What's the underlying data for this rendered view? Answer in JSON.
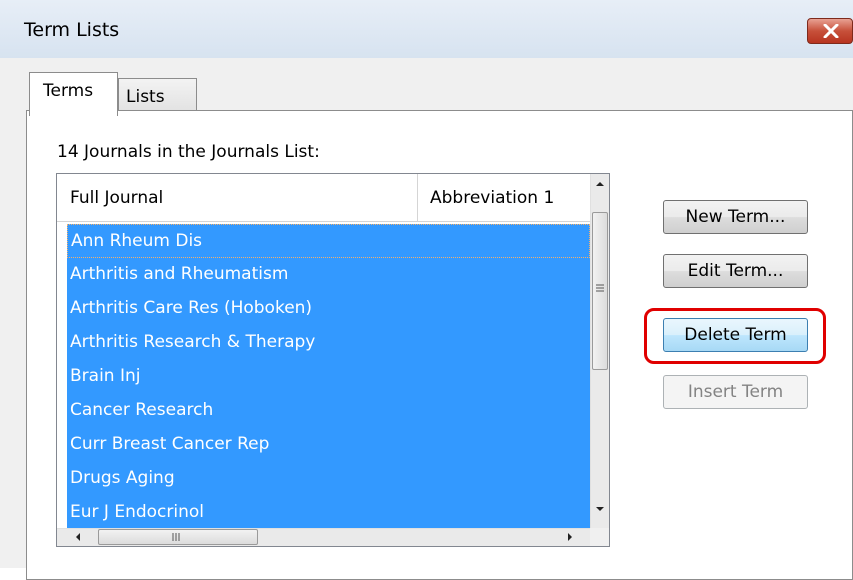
{
  "window": {
    "title": "Term Lists"
  },
  "tabs": [
    {
      "label": "Terms"
    },
    {
      "label": "Lists"
    }
  ],
  "count_label": "14 Journals in the Journals List:",
  "list": {
    "columns": [
      "Full Journal",
      "Abbreviation 1"
    ],
    "rows": [
      "Ann Rheum Dis",
      "Arthritis and Rheumatism",
      "Arthritis Care Res (Hoboken)",
      "Arthritis Research & Therapy",
      "Brain Inj",
      "Cancer Research",
      "Curr Breast Cancer Rep",
      "Drugs Aging",
      "Eur J Endocrinol"
    ]
  },
  "buttons": {
    "new_term": "New Term...",
    "edit_term": "Edit Term...",
    "delete_term": "Delete Term",
    "insert_term": "Insert Term"
  },
  "colors": {
    "selection": "#3399ff",
    "highlight": "#e00000",
    "close": "#c7503a"
  }
}
